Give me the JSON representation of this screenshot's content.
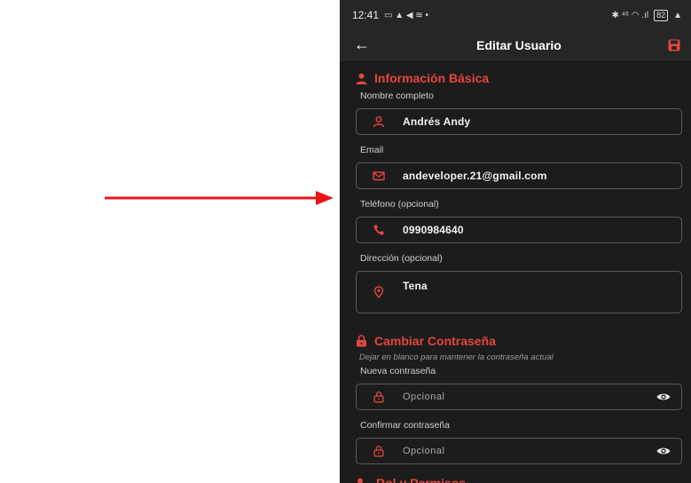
{
  "status_bar": {
    "time": "12:41",
    "left_glyphs": "▭ ▲ ◀ ≋ •",
    "right_glyphs": "✱ ⁴⁶ ◠ .ıl",
    "battery": "82"
  },
  "app_bar": {
    "title": "Editar Usuario"
  },
  "basic_info": {
    "title": "Información Básica",
    "name_label": "Nombre completo",
    "name_value": "Andrés Andy",
    "email_label": "Email",
    "email_value": "andeveloper.21@gmail.com",
    "phone_label": "Teléfono (opcional)",
    "phone_value": "0990984640",
    "address_label": "Dirección (opcional)",
    "address_value": "Tena"
  },
  "password": {
    "title": "Cambiar Contraseña",
    "hint": "Dejar en blanco para mantener la contraseña actual",
    "new_label": "Nueva contraseña",
    "new_placeholder": "Opcional",
    "confirm_label": "Confirmar contraseña",
    "confirm_placeholder": "Opcional"
  },
  "roles": {
    "title": "Rol y Permisos"
  },
  "colors": {
    "accent": "#e5453d",
    "background": "#1c1c1c",
    "appbar": "#262626",
    "field_border": "#5a5a5a",
    "annotation_arrow": "#e8141a"
  }
}
